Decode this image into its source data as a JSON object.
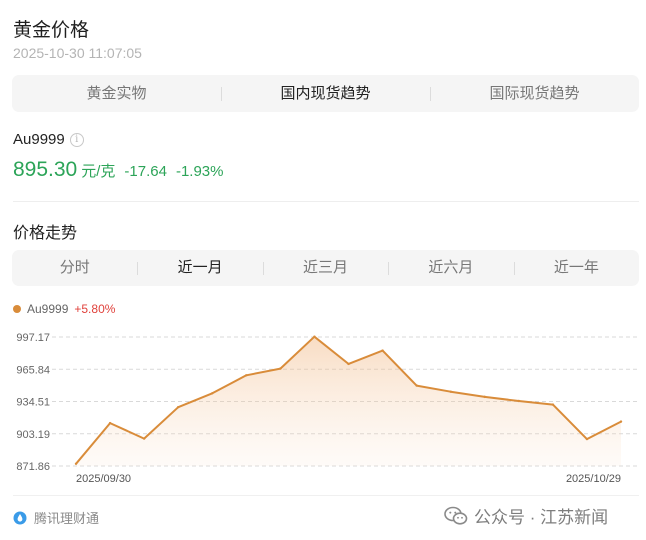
{
  "header": {
    "title": "黄金价格",
    "timestamp": "2025-10-30 11:07:05"
  },
  "tabs": [
    {
      "label": "黄金实物",
      "active": false
    },
    {
      "label": "国内现货趋势",
      "active": true
    },
    {
      "label": "国际现货趋势",
      "active": false
    }
  ],
  "quote": {
    "symbol": "Au9999",
    "info_icon": "info-icon",
    "price": "895.30",
    "unit": "元/克",
    "change": "-17.64",
    "change_pct": "-1.93%",
    "color": "#2ca458"
  },
  "trend": {
    "section_title": "价格走势",
    "ranges": [
      {
        "label": "分时",
        "active": false
      },
      {
        "label": "近一月",
        "active": true
      },
      {
        "label": "近三月",
        "active": false
      },
      {
        "label": "近六月",
        "active": false
      },
      {
        "label": "近一年",
        "active": false
      }
    ]
  },
  "chart_data": {
    "type": "area",
    "series": [
      {
        "name": "Au9999",
        "change_label": "+5.80%",
        "color": "#d98c3a",
        "values": [
          874.0,
          913.5,
          898.5,
          929.0,
          942.5,
          960.0,
          966.5,
          997.5,
          971.0,
          984.0,
          950.0,
          944.0,
          939.0,
          935.0,
          931.5,
          898.0,
          915.0
        ]
      }
    ],
    "y_ticks": [
      "997.17",
      "965.84",
      "934.51",
      "903.19",
      "871.86"
    ],
    "ylim": [
      871.86,
      997.17
    ],
    "x_tick_labels": [
      "2025/09/30",
      "2025/10/29"
    ],
    "grid": true,
    "legend_placement": "top-left"
  },
  "footer": {
    "source_label": "腾讯理财通",
    "source_icon": "droplet-icon",
    "watermark_label": "公众号 · 江苏新闻",
    "watermark_icon": "wechat-icon"
  },
  "colors": {
    "up": "#e0413b",
    "down": "#2ca458",
    "line": "#d98c3a"
  }
}
